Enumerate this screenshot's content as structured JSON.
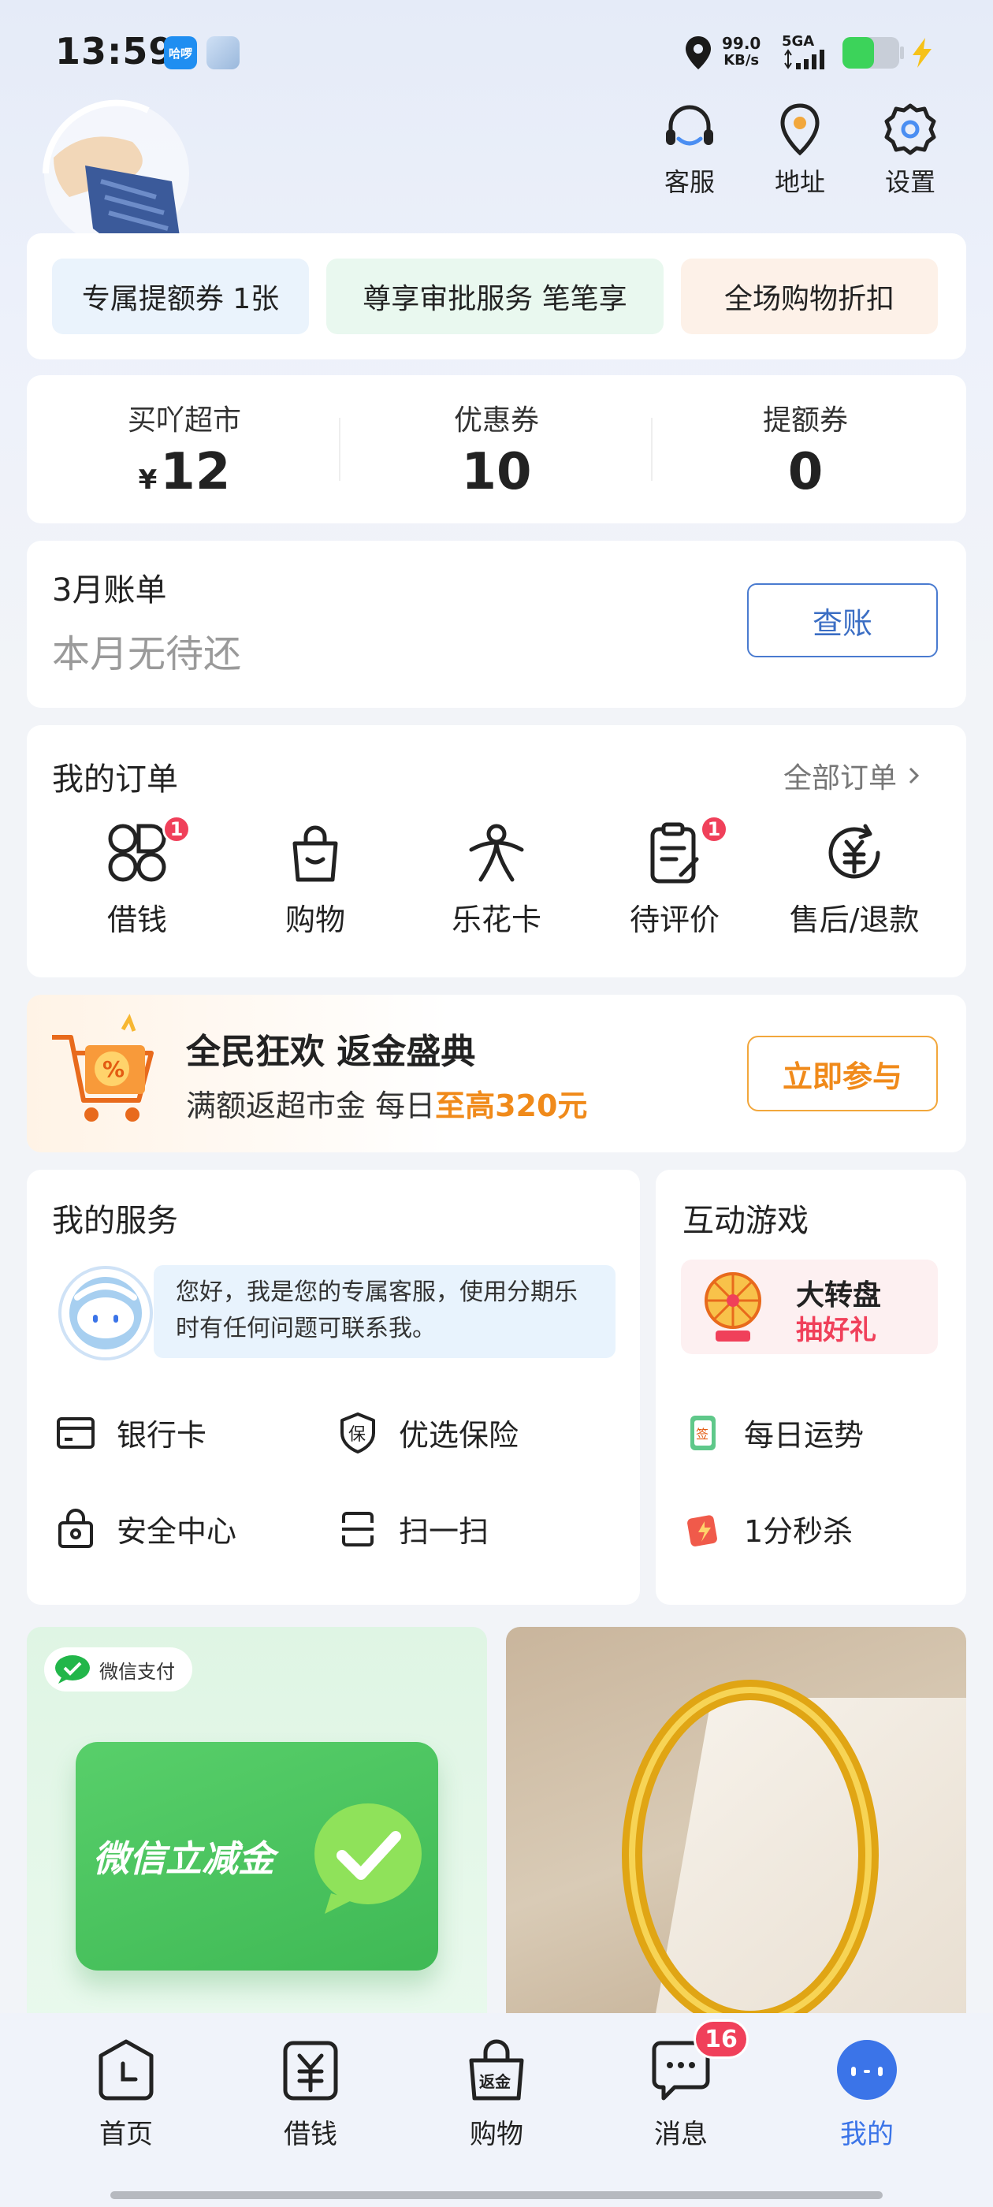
{
  "status_bar": {
    "time": "13:59",
    "app_badge": "哈啰",
    "net_speed_value": "99.0",
    "net_speed_unit": "KB/s",
    "network": "5GA"
  },
  "header": {
    "actions": [
      {
        "label": "客服",
        "icon": "customer-service-icon"
      },
      {
        "label": "地址",
        "icon": "location-pin-icon"
      },
      {
        "label": "设置",
        "icon": "gear-icon"
      }
    ]
  },
  "promo_chips": [
    "专属提额券 1张",
    "尊享审批服务 笔笔享",
    "全场购物折扣"
  ],
  "stats": [
    {
      "label": "买吖超市",
      "prefix": "¥",
      "value": "12"
    },
    {
      "label": "优惠券",
      "prefix": "",
      "value": "10"
    },
    {
      "label": "提额券",
      "prefix": "",
      "value": "0"
    }
  ],
  "bill": {
    "title": "3月账单",
    "subtitle": "本月无待还",
    "button": "查账"
  },
  "orders": {
    "title": "我的订单",
    "all_link": "全部订单",
    "items": [
      {
        "label": "借钱",
        "badge": "1",
        "icon": "clover-icon"
      },
      {
        "label": "购物",
        "badge": "",
        "icon": "shopping-bag-icon"
      },
      {
        "label": "乐花卡",
        "badge": "",
        "icon": "flower-card-icon"
      },
      {
        "label": "待评价",
        "badge": "1",
        "icon": "clipboard-edit-icon"
      },
      {
        "label": "售后/退款",
        "badge": "",
        "icon": "refund-icon"
      }
    ]
  },
  "event": {
    "title": "全民狂欢 返金盛典",
    "subtitle_prefix": "满额返超市金 每日",
    "subtitle_highlight": "至高320元",
    "button": "立即参与"
  },
  "services": {
    "title": "我的服务",
    "bot_message": "您好，我是您的专属客服，使用分期乐时有任何问题可联系我。",
    "items": [
      {
        "label": "银行卡",
        "icon": "bank-card-icon"
      },
      {
        "label": "优选保险",
        "icon": "insurance-shield-icon"
      },
      {
        "label": "安全中心",
        "icon": "security-lock-icon"
      },
      {
        "label": "扫一扫",
        "icon": "scan-icon"
      }
    ]
  },
  "games": {
    "title": "互动游戏",
    "wheel_title": "大转盘",
    "wheel_sub": "抽好礼",
    "items": [
      {
        "label": "每日运势",
        "icon": "fortune-card-icon"
      },
      {
        "label": "1分秒杀",
        "icon": "flash-sale-icon"
      }
    ]
  },
  "banners": {
    "wechat_pay_tag": "微信支付",
    "wechat_banner_text": "微信立减金"
  },
  "bottom_nav": [
    {
      "label": "首页",
      "icon": "clock-home-icon",
      "active": false,
      "badge": ""
    },
    {
      "label": "借钱",
      "icon": "yuan-icon",
      "active": false,
      "badge": ""
    },
    {
      "label": "购物",
      "icon": "cashback-bag-icon",
      "active": false,
      "badge": ""
    },
    {
      "label": "消息",
      "icon": "chat-bubble-icon",
      "active": false,
      "badge": "16"
    },
    {
      "label": "我的",
      "icon": "profile-face-icon",
      "active": true,
      "badge": ""
    }
  ],
  "nav_shop_icon_text": "返金",
  "colors": {
    "accent_blue": "#3b74e8",
    "badge_red": "#f0405a",
    "highlight_orange": "#f08a1a",
    "wechat_green": "#22b64a"
  }
}
